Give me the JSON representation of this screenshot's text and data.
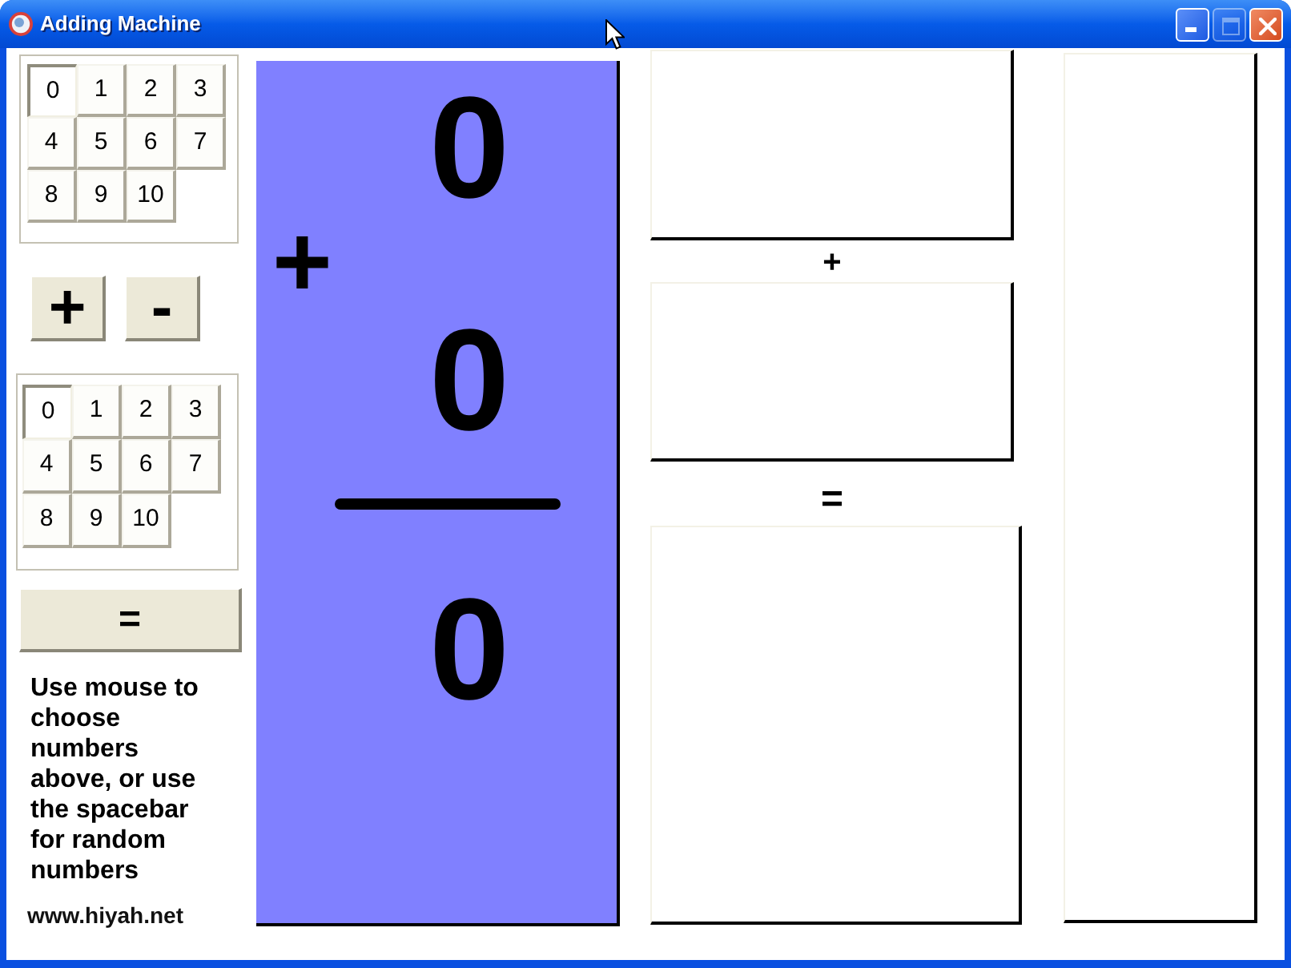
{
  "window": {
    "title": "Adding Machine",
    "controls": [
      {
        "kind": "minimize",
        "disabled": false
      },
      {
        "kind": "maximize",
        "disabled": true
      },
      {
        "kind": "close",
        "disabled": false
      }
    ]
  },
  "first_number_pad": {
    "keys": [
      {
        "label": "0",
        "selected": true
      },
      {
        "label": "1",
        "selected": false
      },
      {
        "label": "2",
        "selected": false
      },
      {
        "label": "3",
        "selected": false
      },
      {
        "label": "4",
        "selected": false
      },
      {
        "label": "5",
        "selected": false
      },
      {
        "label": "6",
        "selected": false
      },
      {
        "label": "7",
        "selected": false
      },
      {
        "label": "8",
        "selected": false
      },
      {
        "label": "9",
        "selected": false
      },
      {
        "label": "10",
        "selected": false
      }
    ]
  },
  "operator_buttons": [
    {
      "label": "+"
    },
    {
      "label": "-"
    }
  ],
  "second_number_pad": {
    "keys": [
      {
        "label": "0",
        "selected": true
      },
      {
        "label": "1",
        "selected": false
      },
      {
        "label": "2",
        "selected": false
      },
      {
        "label": "3",
        "selected": false
      },
      {
        "label": "4",
        "selected": false
      },
      {
        "label": "5",
        "selected": false
      },
      {
        "label": "6",
        "selected": false
      },
      {
        "label": "7",
        "selected": false
      },
      {
        "label": "8",
        "selected": false
      },
      {
        "label": "9",
        "selected": false
      },
      {
        "label": "10",
        "selected": false
      }
    ]
  },
  "equals_button": {
    "label": "="
  },
  "instructions": "Use mouse to choose numbers above, or use the spacebar for random numbers",
  "website": "www.hiyah.net",
  "problem_card": {
    "first_number": "0",
    "operator": "+",
    "second_number": "0",
    "answer": "0"
  },
  "work_column": [
    {
      "kind": "box"
    },
    {
      "kind": "sign",
      "label": "+"
    },
    {
      "kind": "box"
    },
    {
      "kind": "sign",
      "label": "="
    },
    {
      "kind": "box"
    }
  ]
}
